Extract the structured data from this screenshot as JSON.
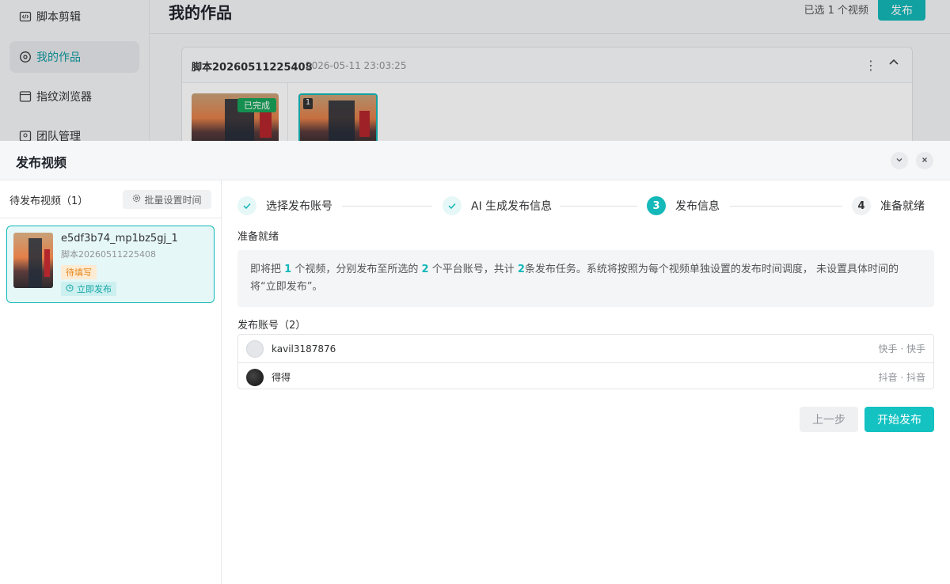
{
  "sidebar": {
    "items": [
      {
        "label": "脚本剪辑",
        "icon": "code-icon",
        "active": false
      },
      {
        "label": "我的作品",
        "icon": "video-icon",
        "active": true
      },
      {
        "label": "指纹浏览器",
        "icon": "browser-icon",
        "active": false
      },
      {
        "label": "团队管理",
        "icon": "team-icon",
        "active": false
      }
    ]
  },
  "main": {
    "title": "我的作品",
    "selected_text": "已选 1 个视频",
    "publish_label": "发布",
    "script": {
      "name": "脚本20260511225408",
      "time": "2026-05-11 23:03:25",
      "thumb_done_badge": "已完成",
      "thumb_index": "1"
    }
  },
  "dialog": {
    "title": "发布视频",
    "left": {
      "title": "待发布视频（1）",
      "batch_label": "批量设置时间",
      "video": {
        "name": "e5df3b74_mp1bz5gj_1",
        "script": "脚本20260511225408",
        "status": "待填写",
        "schedule": "立即发布"
      }
    },
    "steps": [
      {
        "label": "选择发布账号",
        "state": "done"
      },
      {
        "label": "AI 生成发布信息",
        "state": "done"
      },
      {
        "label": "发布信息",
        "state": "active",
        "num": "3"
      },
      {
        "label": "准备就绪",
        "state": "todo",
        "num": "4"
      }
    ],
    "ready_title": "准备就绪",
    "info": {
      "p1": "即将把",
      "videos": "1",
      "p2": "个视频，分别发布至所选的",
      "accounts": "2",
      "p3": "个平台账号，共计",
      "tasks": "2",
      "p4": "条发布任务。系统将按照为每个视频单独设置的发布时间调度， 未设置具体时间的将“立即发布”。"
    },
    "accounts_title": "发布账号（2）",
    "accounts": [
      {
        "name": "kavil3187876",
        "platform": "快手 · 快手"
      },
      {
        "name": "得得",
        "platform": "抖音 · 抖音"
      }
    ],
    "prev_label": "上一步",
    "start_label": "开始发布"
  },
  "colors": {
    "accent": "#14b8b8",
    "pending": "#e6861a",
    "done_badge": "#19a35a"
  }
}
